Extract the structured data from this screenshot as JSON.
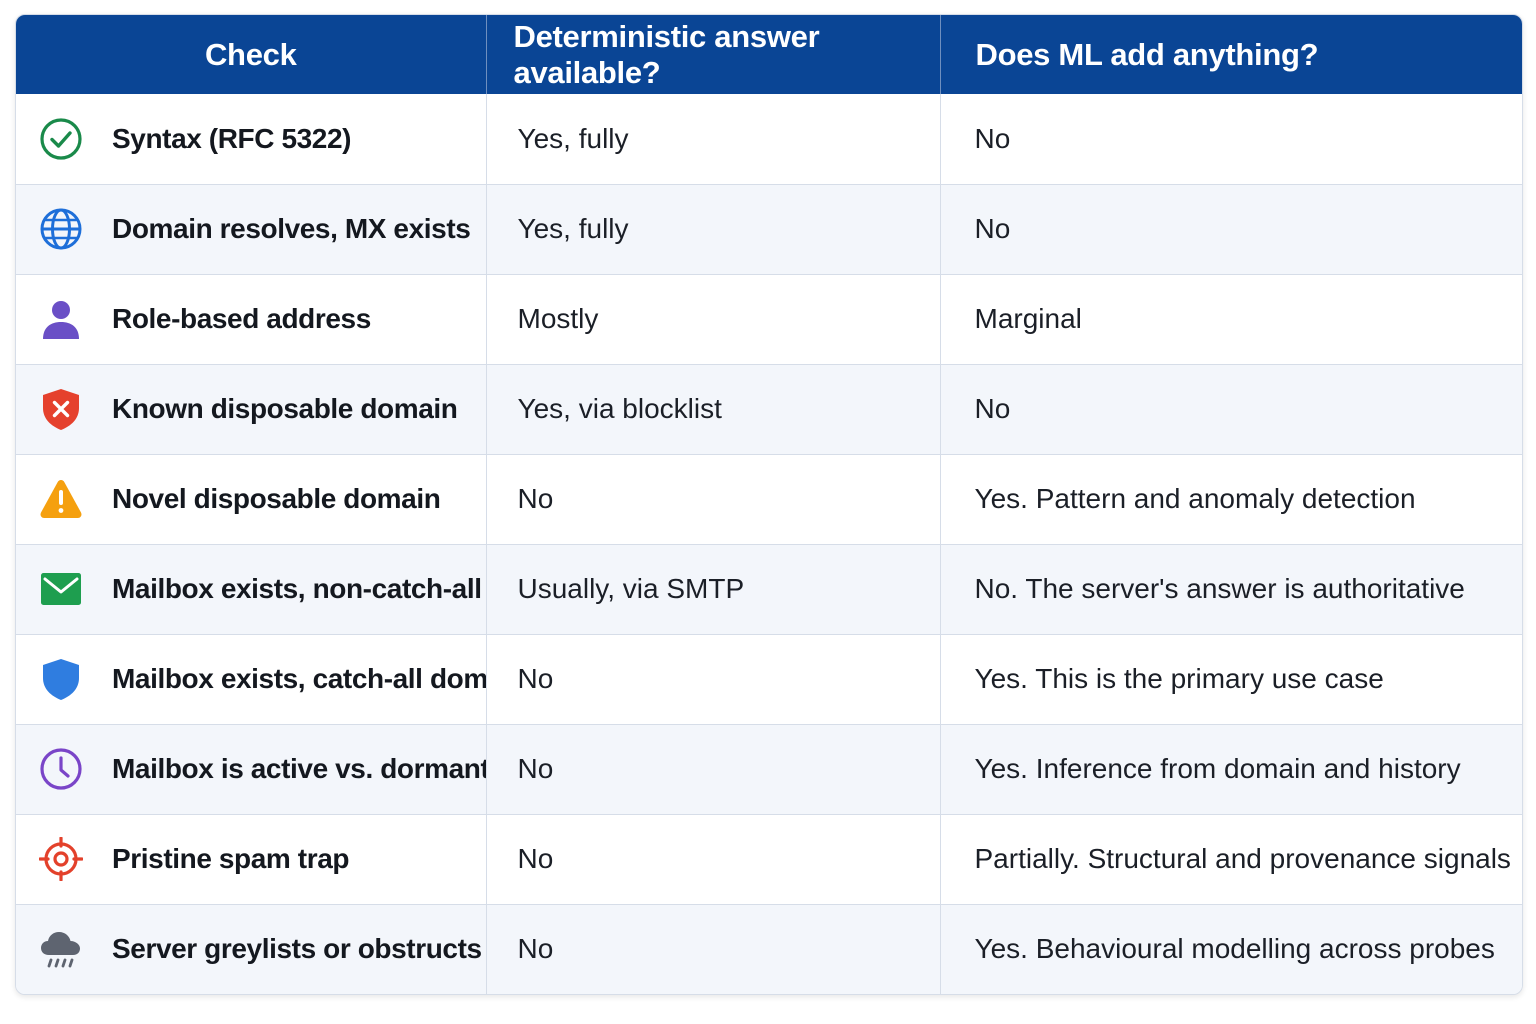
{
  "header": {
    "col_check": "Check",
    "col_deterministic": "Deterministic answer available?",
    "col_ml": "Does ML add anything?"
  },
  "rows": [
    {
      "icon": "check-circle-icon",
      "check": "Syntax (RFC 5322)",
      "deterministic": "Yes, fully",
      "ml": "No"
    },
    {
      "icon": "globe-icon",
      "check": "Domain resolves, MX exists",
      "deterministic": "Yes, fully",
      "ml": "No"
    },
    {
      "icon": "person-icon",
      "check": "Role-based address",
      "deterministic": "Mostly",
      "ml": "Marginal"
    },
    {
      "icon": "shield-x-icon",
      "check": "Known disposable domain",
      "deterministic": "Yes, via blocklist",
      "ml": "No"
    },
    {
      "icon": "warning-icon",
      "check": "Novel disposable domain",
      "deterministic": "No",
      "ml": "Yes. Pattern and anomaly detection"
    },
    {
      "icon": "envelope-icon",
      "check": "Mailbox exists, non-catch-all",
      "deterministic": "Usually, via SMTP",
      "ml": "No. The server's answer is authoritative"
    },
    {
      "icon": "shield-icon",
      "check": "Mailbox exists, catch-all domain",
      "deterministic": "No",
      "ml": "Yes. This is the primary use case"
    },
    {
      "icon": "clock-icon",
      "check": "Mailbox is active vs. dormant",
      "deterministic": "No",
      "ml": "Yes. Inference from domain and history"
    },
    {
      "icon": "target-icon",
      "check": "Pristine spam trap",
      "deterministic": "No",
      "ml": "Partially. Structural and provenance signals"
    },
    {
      "icon": "cloud-rain-icon",
      "check": "Server greylists or obstructs",
      "deterministic": "No",
      "ml": "Yes. Behavioural modelling across probes"
    }
  ],
  "colors": {
    "header_bg": "#0a4595",
    "zebra_bg": "#f3f6fb",
    "check_green": "#1a8a4a",
    "globe_blue": "#1e6fd9",
    "person_purple": "#6a4fc6",
    "shield_red": "#e5412d",
    "warning_orange": "#f5a00f",
    "envelope_green": "#1e9e4f",
    "shield_blue": "#2f7de0",
    "clock_purple": "#7a45c8",
    "target_red": "#e3412b",
    "cloud_gray": "#5e6470"
  }
}
